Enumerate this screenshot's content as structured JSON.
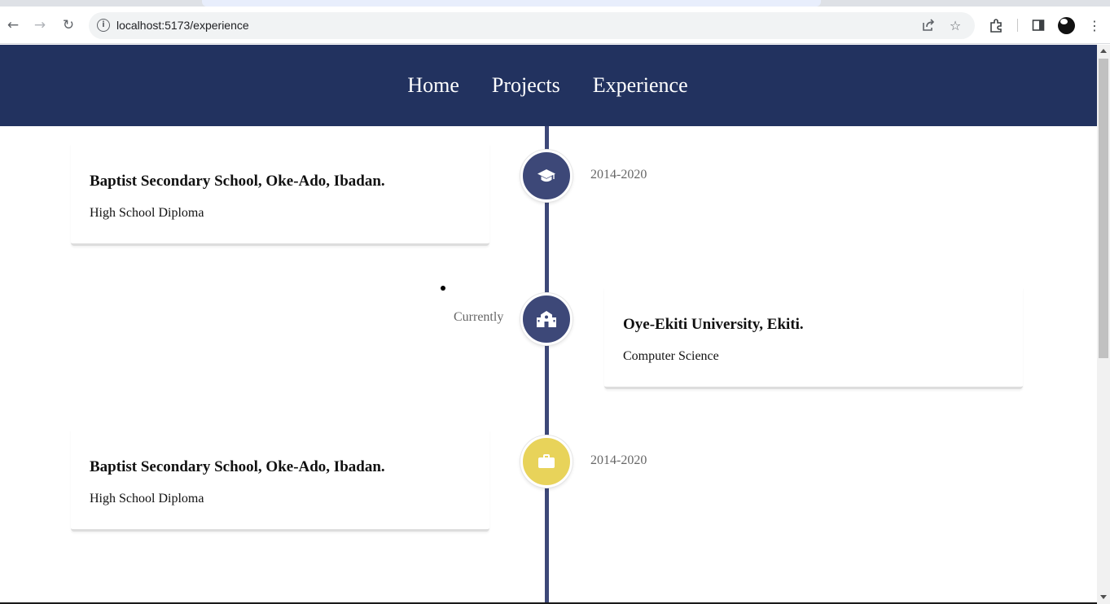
{
  "browser": {
    "url": "localhost:5173/experience",
    "icons": [
      "back-icon",
      "forward-icon",
      "reload-icon",
      "site-info-icon",
      "share-icon",
      "bookmark-star-icon",
      "extensions-icon",
      "side-panel-icon",
      "profile-avatar",
      "menu-icon"
    ]
  },
  "nav": {
    "items": [
      "Home",
      "Projects",
      "Experience"
    ]
  },
  "timeline": {
    "items": [
      {
        "title": "Baptist Secondary School, Oke-Ado, Ibadan.",
        "subtitle": "High School Diploma",
        "date": "2014-2020",
        "icon": "graduation-cap-icon",
        "color": "#3d4878"
      },
      {
        "title": "Oye-Ekiti University, Ekiti.",
        "subtitle": "Computer Science",
        "date": "Currently",
        "icon": "school-building-icon",
        "color": "#3d4878"
      },
      {
        "title": "Baptist Secondary School, Oke-Ado, Ibadan.",
        "subtitle": "High School Diploma",
        "date": "2014-2020",
        "icon": "briefcase-icon",
        "color": "#e8d35a"
      }
    ]
  },
  "colors": {
    "navbar": "#22325f",
    "timeline": "#3d4878",
    "accent_yellow": "#e8d35a"
  }
}
